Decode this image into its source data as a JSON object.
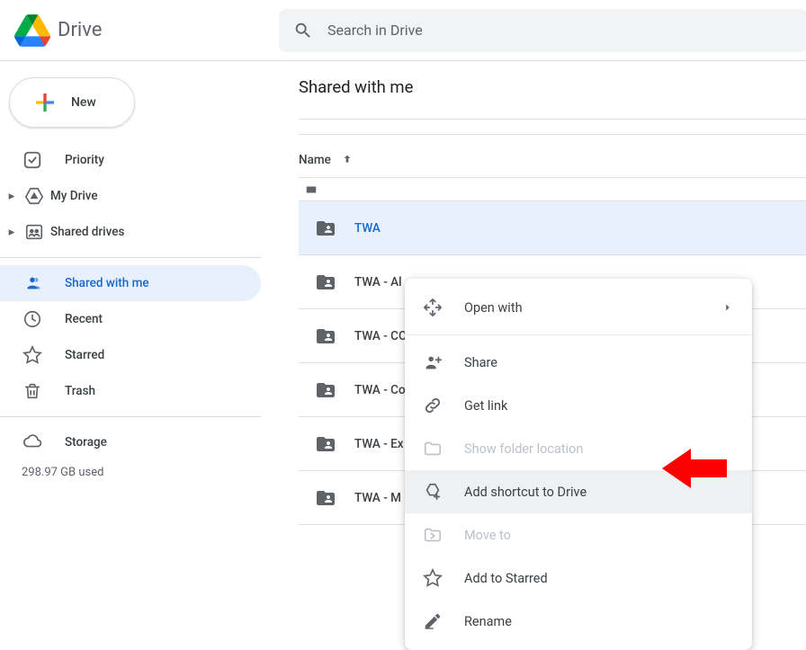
{
  "app": {
    "name": "Drive"
  },
  "search": {
    "placeholder": "Search in Drive"
  },
  "sidebar": {
    "new_label": "New",
    "items": [
      {
        "label": "Priority",
        "icon": "priority"
      },
      {
        "label": "My Drive",
        "icon": "mydrive",
        "expandable": true
      },
      {
        "label": "Shared drives",
        "icon": "shareddrives",
        "expandable": true
      },
      {
        "label": "Shared with me",
        "icon": "sharedwithme",
        "active": true
      },
      {
        "label": "Recent",
        "icon": "recent"
      },
      {
        "label": "Starred",
        "icon": "starred"
      },
      {
        "label": "Trash",
        "icon": "trash"
      }
    ],
    "storage": {
      "label": "Storage",
      "used": "298.97 GB used"
    }
  },
  "main": {
    "title": "Shared with me",
    "col_name": "Name",
    "rows": [
      {
        "name": "TWA",
        "selected": true
      },
      {
        "name": "TWA - Al"
      },
      {
        "name": "TWA - CO"
      },
      {
        "name": "TWA - Co"
      },
      {
        "name": "TWA - Ex"
      },
      {
        "name": "TWA - M"
      }
    ]
  },
  "menu": {
    "items": [
      {
        "label": "Open with",
        "icon": "openwith",
        "submenu": true
      },
      {
        "label": "Share",
        "icon": "share"
      },
      {
        "label": "Get link",
        "icon": "link"
      },
      {
        "label": "Show folder location",
        "icon": "folder",
        "disabled": true
      },
      {
        "label": "Add shortcut to Drive",
        "icon": "shortcut",
        "highlight": true
      },
      {
        "label": "Move to",
        "icon": "moveto",
        "disabled": true
      },
      {
        "label": "Add to Starred",
        "icon": "star"
      },
      {
        "label": "Rename",
        "icon": "rename"
      }
    ]
  }
}
